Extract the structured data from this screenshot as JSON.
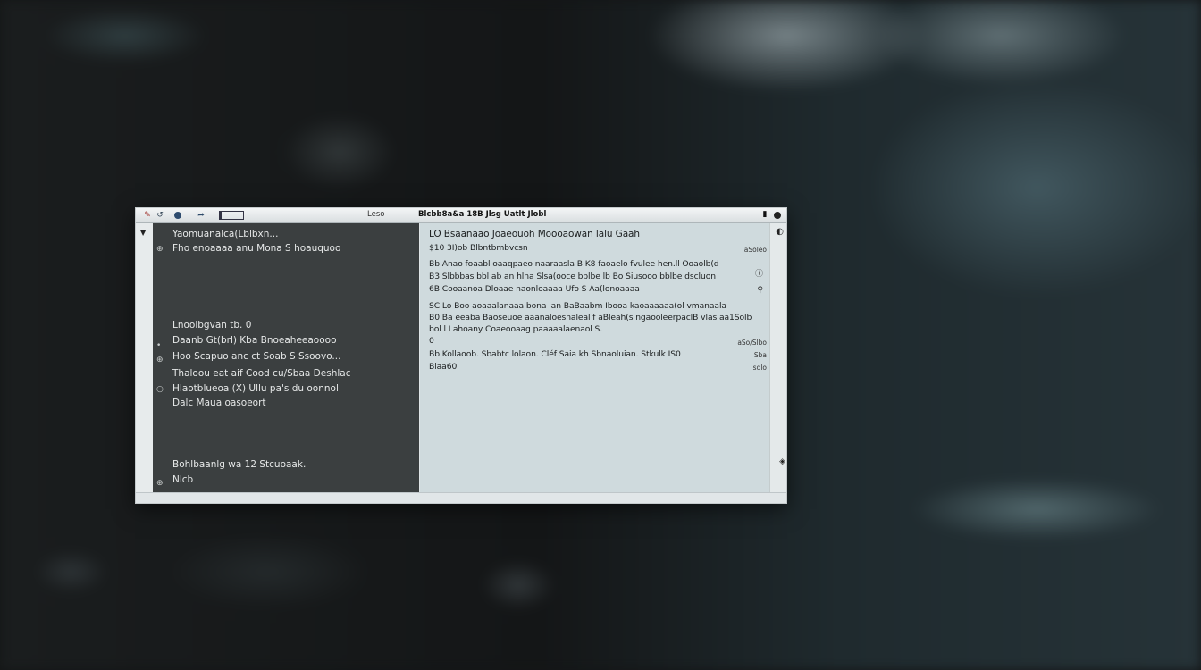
{
  "window": {
    "toolbar_mid": "Leso",
    "title": "Blcbb8a&a  18B  Jlsg Uatlt Jlobl"
  },
  "gutter": {
    "toggle_icon": "triangle-down-icon"
  },
  "left_pane": {
    "lines": [
      "Yaomuanalca(Lblbxn...",
      "Fho enoaaaa anu Mona S hoauquoo",
      "Lnoolbgvan tb. 0",
      "Daanb Gt(brl) Kba Bnoeaheeaoooo",
      "Hoo Scapuo anc ct Soab S Ssoovo...",
      "Thaloou eat  aif Cood cu/Sbaa Deshlac",
      "Hlaotblueoa (X) Ullu pa's du oonnol",
      "Dalc Maua oasoeort",
      "Bohlbaanlg wa 12 Stcuoaak.",
      "Nlcb"
    ]
  },
  "right_pane": {
    "lines": [
      "LO  Bsaanaao Joaeouoh  Moooaowan  lalu Gaah",
      "$10 3I)ob  Blbntbmbvcsn",
      "Bb  Anao foaabl oaaqpaeo naaraasla B K8  faoaelo fvulee hen.ll Ooaolb(d",
      "B3  Slbbbas  bbl ab an hlna Slsa(ooce bblbe  lb Bo  Siusooo bblbe dscluon",
      "6B  Cooaanoa  Dloaae naonloaaaa  Ufo S Aa(lonoaaaa",
      "SC  Lo Boo aoaaalanaaa bona lan BaBaabm Ibooa  kaoaaaaaa(ol vmanaala",
      "B0  Ba eeaba  Baoseuoe  aaanaloesnaleal f aBleah(s  ngaooleerpaclB  vlas aa1Solb",
      "bol  l  Lahoany  Coaeooaag  paaaaalaenaol S.",
      "0",
      "Bb  Kollaoob.     Sbabtc lolaon.     Cléf  Saia  kh Sbnaoluian.   Stkulk IS0",
      "Blaa60"
    ],
    "side_labels": [
      "aSoleo",
      "aSo/Slbo",
      "Sba",
      "sdlo"
    ],
    "side_icons": [
      "info-icon",
      "search-icon"
    ]
  },
  "colors": {
    "left_pane_bg": "#3b3f40",
    "right_pane_bg": "#cfdadd",
    "titlebar_bg": "#e8ecee"
  }
}
